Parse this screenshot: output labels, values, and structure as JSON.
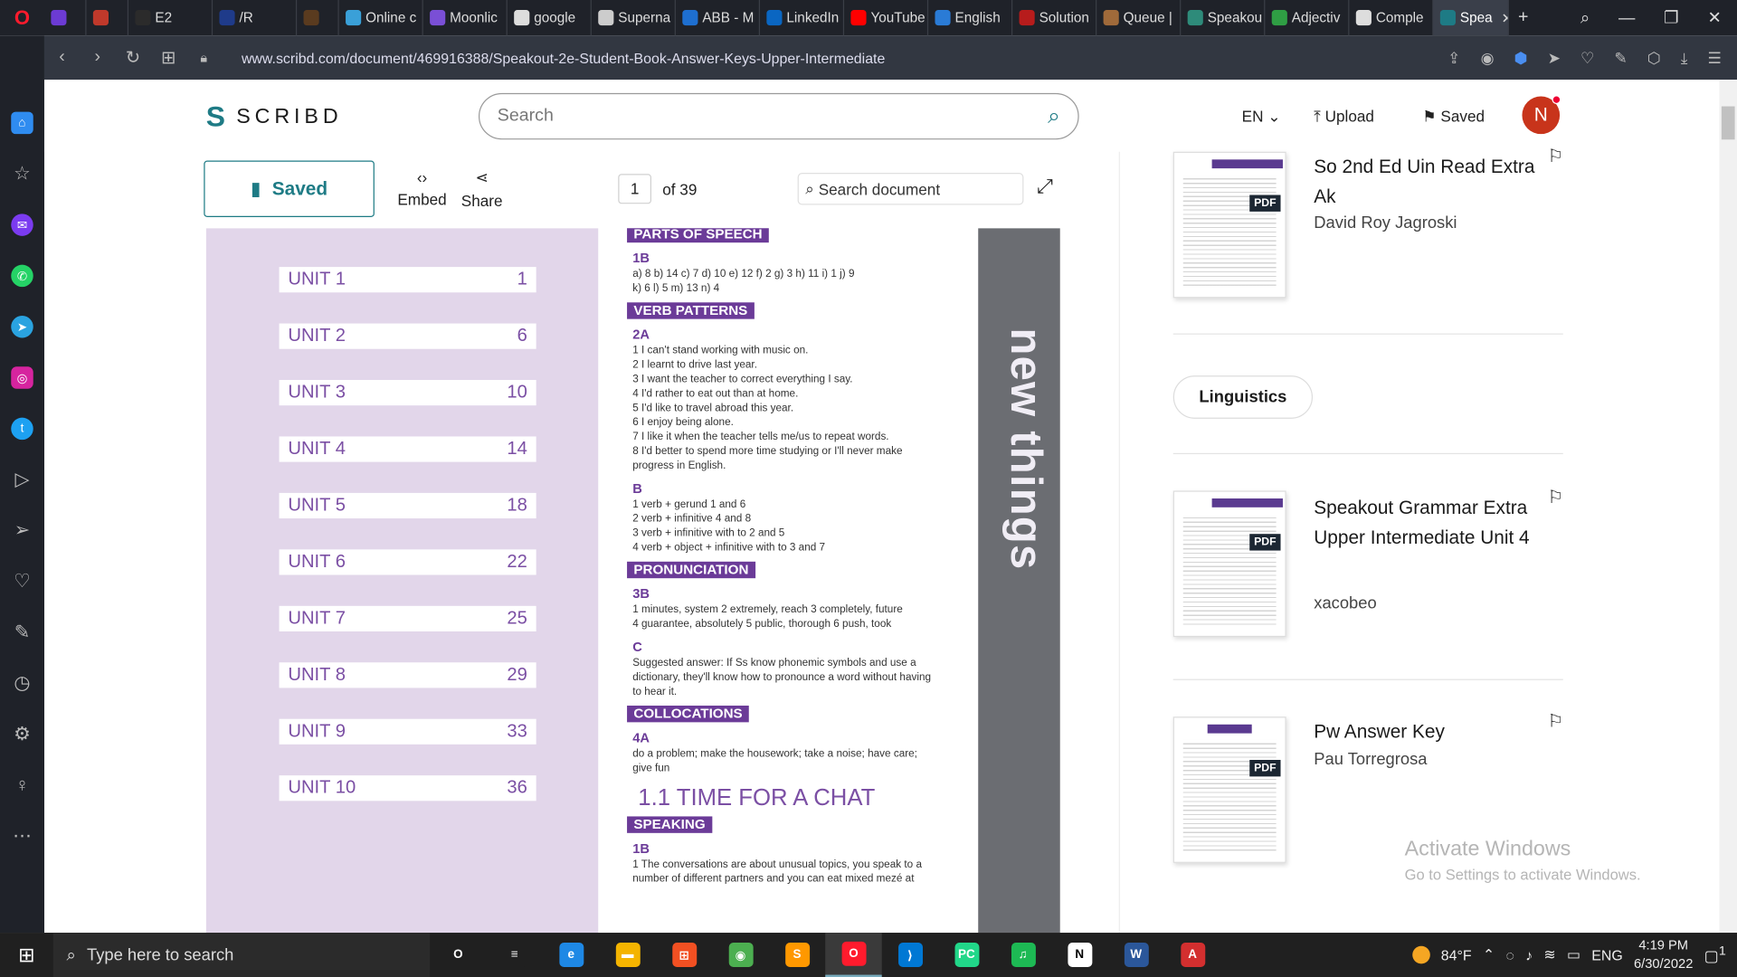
{
  "browser": {
    "tabs": [
      {
        "label": "",
        "color": "#6c3bd4"
      },
      {
        "label": "",
        "color": "#c0392b"
      },
      {
        "label": "E2",
        "color": "#2b2b2b"
      },
      {
        "label": "/R",
        "color": "#1f3b8a"
      },
      {
        "label": "",
        "color": "#5a3b1f"
      },
      {
        "label": "Online c",
        "color": "#3aa0d8"
      },
      {
        "label": "Moonlic",
        "color": "#7a4fd6"
      },
      {
        "label": "google",
        "color": "#dddddd"
      },
      {
        "label": "Superna",
        "color": "#cccccc"
      },
      {
        "label": "ABB - M",
        "color": "#1e6fd0"
      },
      {
        "label": "LinkedIn",
        "color": "#0a66c2"
      },
      {
        "label": "YouTube",
        "color": "#ff0000"
      },
      {
        "label": "English",
        "color": "#2a7bd6"
      },
      {
        "label": "Solution",
        "color": "#b71c1c"
      },
      {
        "label": "Queue |",
        "color": "#a06a3a"
      },
      {
        "label": "Speakou",
        "color": "#2e8b7a"
      },
      {
        "label": "Adjectiv",
        "color": "#2f9e44"
      },
      {
        "label": "Comple",
        "color": "#dddddd"
      },
      {
        "label": "Spea",
        "color": "#1e7b85",
        "active": true
      }
    ],
    "url": "www.scribd.com/document/469916388/Speakout-2e-Student-Book-Answer-Keys-Upper-Intermediate"
  },
  "scribd": {
    "logo_text": "SCRIBD",
    "search_placeholder": "Search",
    "lang": "EN",
    "upload": "Upload",
    "saved": "Saved",
    "avatar_initial": "N"
  },
  "toolbar": {
    "saved": "Saved",
    "embed": "Embed",
    "share": "Share",
    "page_current": "1",
    "page_of": "of 39",
    "search_doc_placeholder": "Search document"
  },
  "units": [
    {
      "name": "UNIT 1",
      "page": "1"
    },
    {
      "name": "UNIT 2",
      "page": "6"
    },
    {
      "name": "UNIT 3",
      "page": "10"
    },
    {
      "name": "UNIT 4",
      "page": "14"
    },
    {
      "name": "UNIT 5",
      "page": "18"
    },
    {
      "name": "UNIT 6",
      "page": "22"
    },
    {
      "name": "UNIT 7",
      "page": "25"
    },
    {
      "name": "UNIT 8",
      "page": "29"
    },
    {
      "name": "UNIT 9",
      "page": "33"
    },
    {
      "name": "UNIT 10",
      "page": "36"
    }
  ],
  "document": {
    "parts_header": "PARTS OF SPEECH",
    "s1b_label": "1B",
    "s1b_line1": "a) 8   b) 14   c) 7   d) 10   e) 12   f) 2   g) 3   h) 11   i) 1   j) 9",
    "s1b_line2": "k) 6   l) 5   m) 13   n) 4",
    "verb_header": "VERB PATTERNS",
    "s2a_label": "2A",
    "verb_lines": [
      "1  I can't stand working with music on.",
      "2  I learnt to drive last year.",
      "3  I want the teacher to correct everything I say.",
      "4  I'd rather to eat out than at home.",
      "5  I'd like to travel abroad this year.",
      "6  I enjoy being alone.",
      "7  I like it when the teacher tells me/us to repeat words.",
      "8  I'd better to spend more time studying or I'll never make",
      "    progress in English."
    ],
    "b_label": "B",
    "b_lines": [
      "1  verb + gerund  1 and 6",
      "2  verb + infinitive  4 and 8",
      "3  verb + infinitive with to  2 and 5",
      "4  verb + object + infinitive with to  3 and 7"
    ],
    "pron_header": "PRONUNCIATION",
    "s3b_label": "3B",
    "s3b_line1": "1 minutes, system    2 extremely, reach    3 completely, future",
    "s3b_line2": "4 guarantee, absolutely    5 public, thorough    6 push, took",
    "c_label": "C",
    "c_line1": "Suggested answer:  If Ss know phonemic symbols and use a",
    "c_line2": "dictionary, they'll know how to pronounce a word without having",
    "c_line3": "to hear it.",
    "colloc_header": "COLLOCATIONS",
    "s4a_label": "4A",
    "s4a_line1": "do a problem; make the housework; take a noise; have care;",
    "s4a_line2": "give fun",
    "chat_title": "1.1 TIME FOR A CHAT",
    "speaking_header": "SPEAKING",
    "sp1b_label": "1B",
    "sp_line1": "1  The conversations are about unusual topics, you speak to a",
    "sp_line2": "    number of different partners and you can eat mixed mezé at",
    "side_title": "new things"
  },
  "recommendations": [
    {
      "title": "So 2nd Ed Uin Read Extra Ak",
      "author": "David Roy Jagroski",
      "badge": "PDF"
    },
    {
      "title": "Speakout Grammar Extra Upper Intermediate Unit 4",
      "author": "xacobeo",
      "badge": "PDF"
    },
    {
      "title": "Pw Answer Key",
      "author": "Pau Torregrosa",
      "badge": "PDF"
    }
  ],
  "tag": "Linguistics",
  "watermark": {
    "line1": "Activate Windows",
    "line2": "Go to Settings to activate Windows."
  },
  "taskbar": {
    "search_placeholder": "Type here to search",
    "apps": [
      {
        "name": "task-view",
        "label": "O",
        "color": "#202020"
      },
      {
        "name": "multitask",
        "label": "≡",
        "color": "#202020"
      },
      {
        "name": "edge",
        "label": "e",
        "color": "#1e88e5"
      },
      {
        "name": "file-explorer",
        "label": "▬",
        "color": "#f4b400"
      },
      {
        "name": "store",
        "label": "⊞",
        "color": "#f25022"
      },
      {
        "name": "chrome",
        "label": "◉",
        "color": "#4caf50"
      },
      {
        "name": "sublime",
        "label": "S",
        "color": "#ff9800"
      },
      {
        "name": "opera",
        "label": "O",
        "color": "#ff1b2d",
        "active": true
      },
      {
        "name": "vscode",
        "label": "⟩",
        "color": "#0078d4"
      },
      {
        "name": "pycharm",
        "label": "PC",
        "color": "#21d789"
      },
      {
        "name": "spotify",
        "label": "♫",
        "color": "#1db954"
      },
      {
        "name": "notion",
        "label": "N",
        "color": "#ffffff"
      },
      {
        "name": "word",
        "label": "W",
        "color": "#2b579a"
      },
      {
        "name": "acrobat",
        "label": "A",
        "color": "#d32f2f"
      }
    ],
    "weather": "84°F",
    "lang": "ENG",
    "time": "4:19 PM",
    "date": "6/30/2022",
    "notif_count": "1"
  }
}
